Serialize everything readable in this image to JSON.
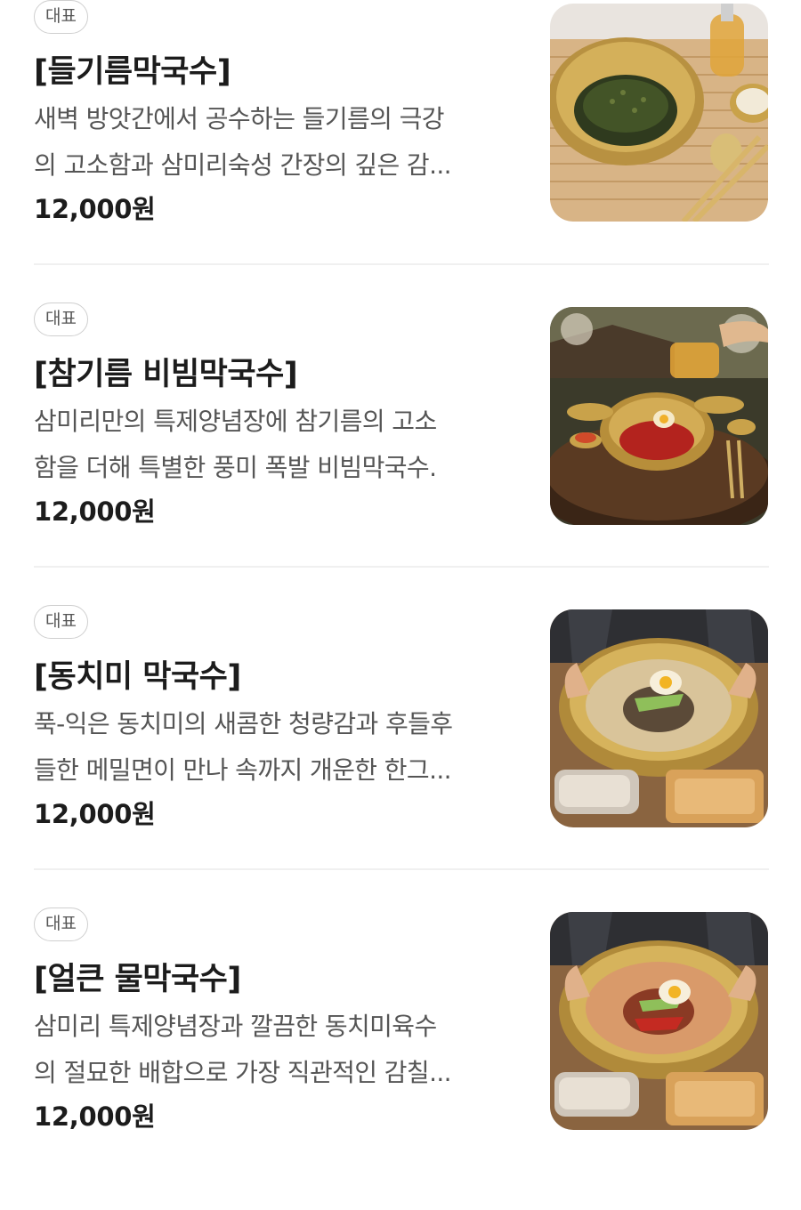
{
  "menu": {
    "items": [
      {
        "badge": "대표",
        "name": "[들기름막국수]",
        "desc_lines": [
          "새벽 방앗간에서 공수하는 들기름의 극강",
          "의 고소함과 삼미리숙성 간장의 깊은 감..."
        ],
        "price": "12,000원",
        "image_icon": "perilla-oil-noodle-photo"
      },
      {
        "badge": "대표",
        "name": "[참기름 비빔막국수]",
        "desc_lines": [
          "삼미리만의 특제양념장에 참기름의 고소",
          "함을 더해 특별한 풍미 폭발 비빔막국수."
        ],
        "price": "12,000원",
        "image_icon": "spicy-bibim-noodle-photo"
      },
      {
        "badge": "대표",
        "name": "[동치미 막국수]",
        "desc_lines": [
          "푹-익은 동치미의 새콤한 청량감과 후들후",
          "들한 메밀면이 만나 속까지 개운한 한그..."
        ],
        "price": "12,000원",
        "image_icon": "dongchimi-noodle-photo"
      },
      {
        "badge": "대표",
        "name": "[얼큰 물막국수]",
        "desc_lines": [
          "삼미리 특제양념장과 깔끔한 동치미육수",
          "의 절묘한 배합으로 가장 직관적인 감칠..."
        ],
        "price": "12,000원",
        "image_icon": "spicy-cold-noodle-photo"
      }
    ]
  },
  "colors": {
    "text_primary": "#1c1c1c",
    "text_secondary": "#555555",
    "badge_border": "#cfcfcf",
    "divider": "#f0f0f0",
    "brass_bowl": "#c9a24a"
  }
}
